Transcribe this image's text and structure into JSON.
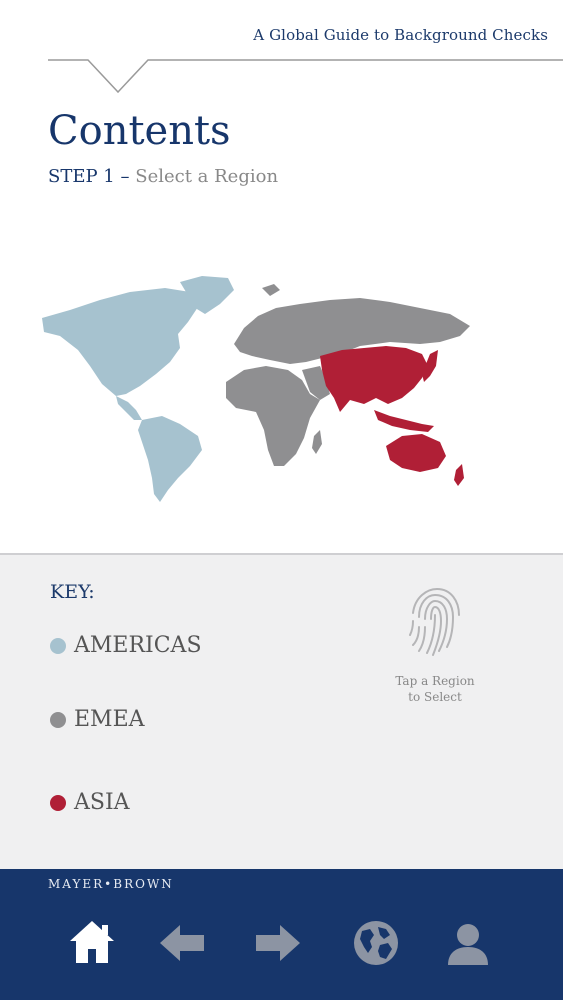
{
  "header": {
    "title": "A Global Guide to Background Checks"
  },
  "page": {
    "title": "Contents",
    "step_label": "STEP 1",
    "step_dash": "–",
    "step_text": "Select a Region"
  },
  "key": {
    "title": "KEY:",
    "items": [
      {
        "label": "AMERICAS",
        "color": "#a6c2cf"
      },
      {
        "label": "EMEA",
        "color": "#8f8f91"
      },
      {
        "label": "ASIA",
        "color": "#b01f36"
      }
    ],
    "hint_line1": "Tap a Region",
    "hint_line2": "to Select",
    "hint_icon": "fingerprint-icon"
  },
  "footer": {
    "brand": "MAYER•BROWN",
    "background": "#17366b",
    "nav": [
      {
        "icon": "home-icon",
        "active": true
      },
      {
        "icon": "back-arrow-icon",
        "active": false
      },
      {
        "icon": "forward-arrow-icon",
        "active": false
      },
      {
        "icon": "globe-icon",
        "active": false
      },
      {
        "icon": "profile-icon",
        "active": false
      }
    ]
  }
}
